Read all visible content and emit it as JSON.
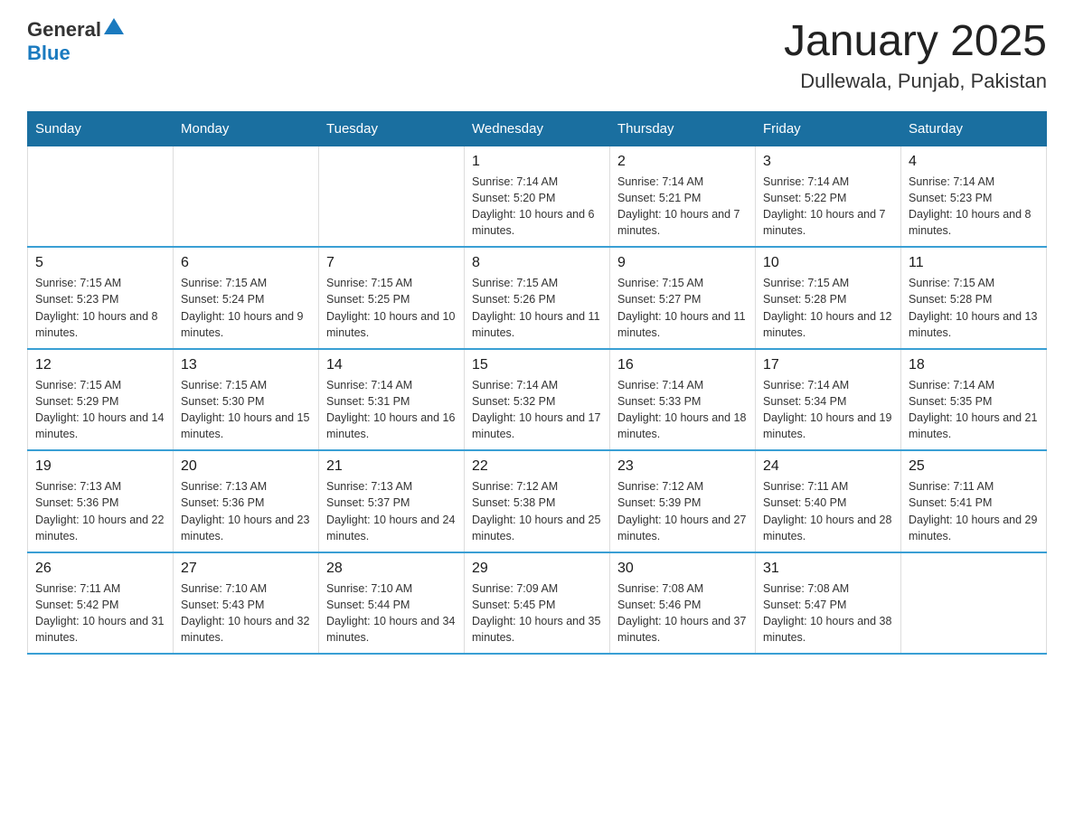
{
  "header": {
    "logo_general": "General",
    "logo_blue": "Blue",
    "title": "January 2025",
    "subtitle": "Dullewala, Punjab, Pakistan"
  },
  "days_of_week": [
    "Sunday",
    "Monday",
    "Tuesday",
    "Wednesday",
    "Thursday",
    "Friday",
    "Saturday"
  ],
  "weeks": [
    [
      {
        "day": "",
        "info": ""
      },
      {
        "day": "",
        "info": ""
      },
      {
        "day": "",
        "info": ""
      },
      {
        "day": "1",
        "info": "Sunrise: 7:14 AM\nSunset: 5:20 PM\nDaylight: 10 hours and 6 minutes."
      },
      {
        "day": "2",
        "info": "Sunrise: 7:14 AM\nSunset: 5:21 PM\nDaylight: 10 hours and 7 minutes."
      },
      {
        "day": "3",
        "info": "Sunrise: 7:14 AM\nSunset: 5:22 PM\nDaylight: 10 hours and 7 minutes."
      },
      {
        "day": "4",
        "info": "Sunrise: 7:14 AM\nSunset: 5:23 PM\nDaylight: 10 hours and 8 minutes."
      }
    ],
    [
      {
        "day": "5",
        "info": "Sunrise: 7:15 AM\nSunset: 5:23 PM\nDaylight: 10 hours and 8 minutes."
      },
      {
        "day": "6",
        "info": "Sunrise: 7:15 AM\nSunset: 5:24 PM\nDaylight: 10 hours and 9 minutes."
      },
      {
        "day": "7",
        "info": "Sunrise: 7:15 AM\nSunset: 5:25 PM\nDaylight: 10 hours and 10 minutes."
      },
      {
        "day": "8",
        "info": "Sunrise: 7:15 AM\nSunset: 5:26 PM\nDaylight: 10 hours and 11 minutes."
      },
      {
        "day": "9",
        "info": "Sunrise: 7:15 AM\nSunset: 5:27 PM\nDaylight: 10 hours and 11 minutes."
      },
      {
        "day": "10",
        "info": "Sunrise: 7:15 AM\nSunset: 5:28 PM\nDaylight: 10 hours and 12 minutes."
      },
      {
        "day": "11",
        "info": "Sunrise: 7:15 AM\nSunset: 5:28 PM\nDaylight: 10 hours and 13 minutes."
      }
    ],
    [
      {
        "day": "12",
        "info": "Sunrise: 7:15 AM\nSunset: 5:29 PM\nDaylight: 10 hours and 14 minutes."
      },
      {
        "day": "13",
        "info": "Sunrise: 7:15 AM\nSunset: 5:30 PM\nDaylight: 10 hours and 15 minutes."
      },
      {
        "day": "14",
        "info": "Sunrise: 7:14 AM\nSunset: 5:31 PM\nDaylight: 10 hours and 16 minutes."
      },
      {
        "day": "15",
        "info": "Sunrise: 7:14 AM\nSunset: 5:32 PM\nDaylight: 10 hours and 17 minutes."
      },
      {
        "day": "16",
        "info": "Sunrise: 7:14 AM\nSunset: 5:33 PM\nDaylight: 10 hours and 18 minutes."
      },
      {
        "day": "17",
        "info": "Sunrise: 7:14 AM\nSunset: 5:34 PM\nDaylight: 10 hours and 19 minutes."
      },
      {
        "day": "18",
        "info": "Sunrise: 7:14 AM\nSunset: 5:35 PM\nDaylight: 10 hours and 21 minutes."
      }
    ],
    [
      {
        "day": "19",
        "info": "Sunrise: 7:13 AM\nSunset: 5:36 PM\nDaylight: 10 hours and 22 minutes."
      },
      {
        "day": "20",
        "info": "Sunrise: 7:13 AM\nSunset: 5:36 PM\nDaylight: 10 hours and 23 minutes."
      },
      {
        "day": "21",
        "info": "Sunrise: 7:13 AM\nSunset: 5:37 PM\nDaylight: 10 hours and 24 minutes."
      },
      {
        "day": "22",
        "info": "Sunrise: 7:12 AM\nSunset: 5:38 PM\nDaylight: 10 hours and 25 minutes."
      },
      {
        "day": "23",
        "info": "Sunrise: 7:12 AM\nSunset: 5:39 PM\nDaylight: 10 hours and 27 minutes."
      },
      {
        "day": "24",
        "info": "Sunrise: 7:11 AM\nSunset: 5:40 PM\nDaylight: 10 hours and 28 minutes."
      },
      {
        "day": "25",
        "info": "Sunrise: 7:11 AM\nSunset: 5:41 PM\nDaylight: 10 hours and 29 minutes."
      }
    ],
    [
      {
        "day": "26",
        "info": "Sunrise: 7:11 AM\nSunset: 5:42 PM\nDaylight: 10 hours and 31 minutes."
      },
      {
        "day": "27",
        "info": "Sunrise: 7:10 AM\nSunset: 5:43 PM\nDaylight: 10 hours and 32 minutes."
      },
      {
        "day": "28",
        "info": "Sunrise: 7:10 AM\nSunset: 5:44 PM\nDaylight: 10 hours and 34 minutes."
      },
      {
        "day": "29",
        "info": "Sunrise: 7:09 AM\nSunset: 5:45 PM\nDaylight: 10 hours and 35 minutes."
      },
      {
        "day": "30",
        "info": "Sunrise: 7:08 AM\nSunset: 5:46 PM\nDaylight: 10 hours and 37 minutes."
      },
      {
        "day": "31",
        "info": "Sunrise: 7:08 AM\nSunset: 5:47 PM\nDaylight: 10 hours and 38 minutes."
      },
      {
        "day": "",
        "info": ""
      }
    ]
  ]
}
